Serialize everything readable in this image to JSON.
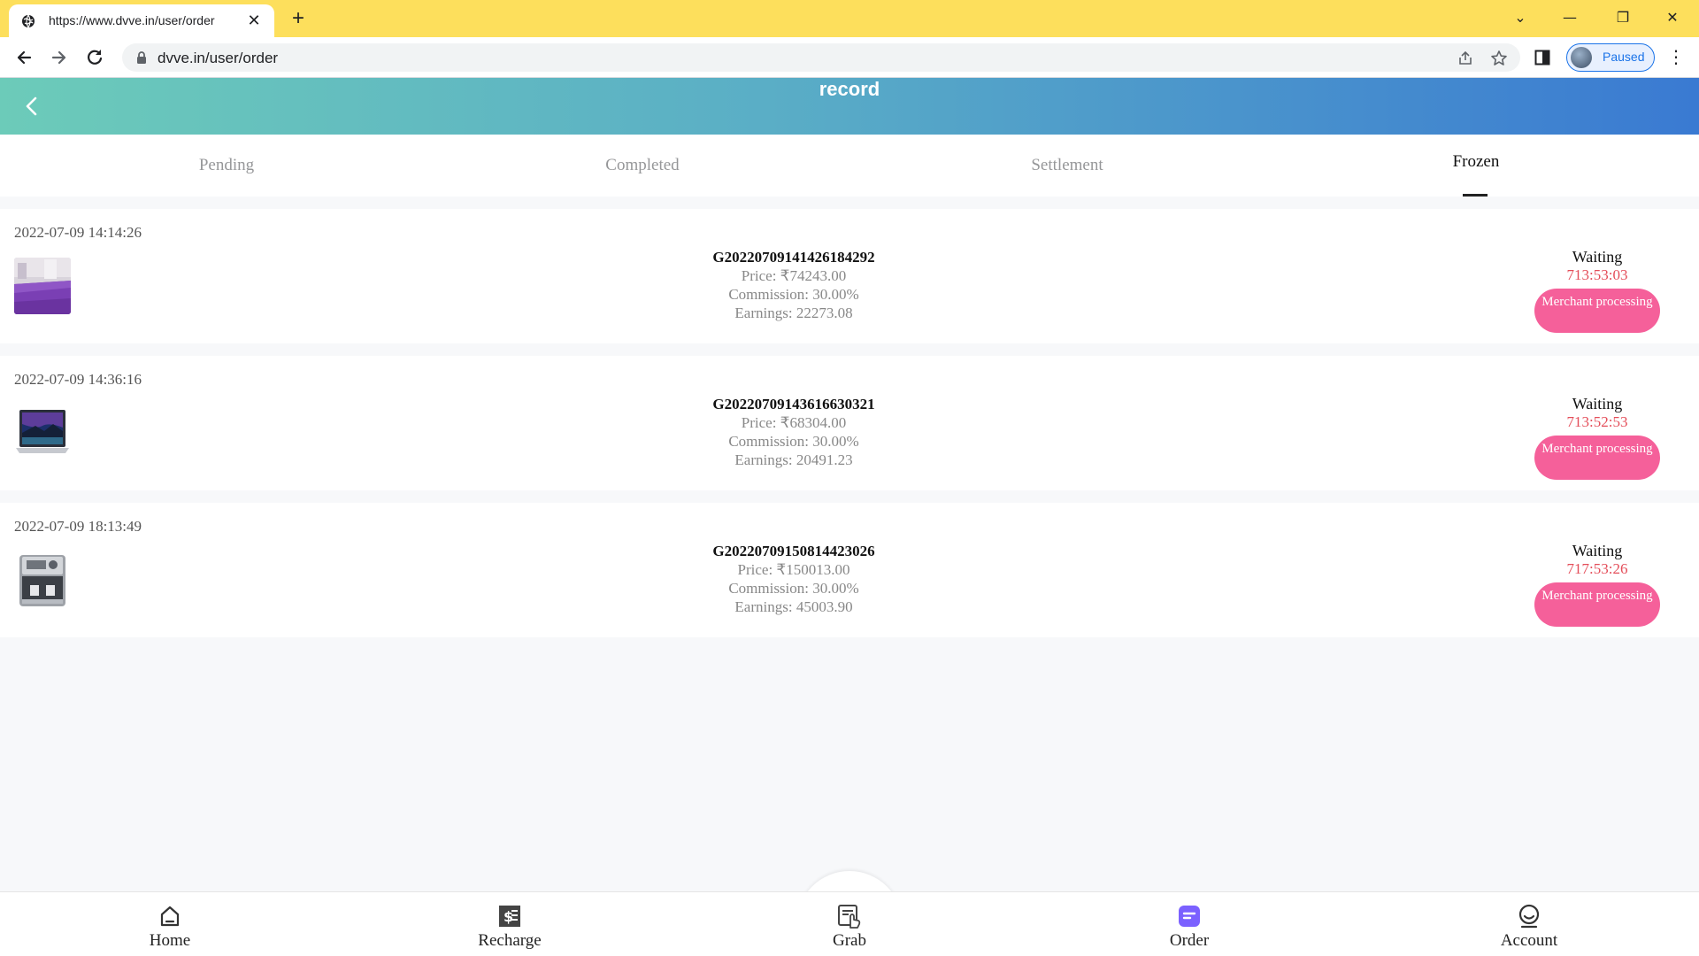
{
  "browser": {
    "tab_title": "https://www.dvve.in/user/order",
    "tab_close": "✕",
    "new_tab": "+",
    "url": "dvve.in/user/order",
    "profile_label": "Paused",
    "menu": "⋮",
    "window_controls": [
      "⌄",
      "—",
      "❐",
      "✕"
    ]
  },
  "header": {
    "title": "record"
  },
  "tabs": [
    {
      "label": "Pending",
      "active": false
    },
    {
      "label": "Completed",
      "active": false
    },
    {
      "label": "Settlement",
      "active": false
    },
    {
      "label": "Frozen",
      "active": true
    }
  ],
  "orders": [
    {
      "date": "2022-07-09 14:14:26",
      "order_no": "G20220709141426184292",
      "price": "Price: ₹74243.00",
      "commission": "Commission: 30.00%",
      "earnings": "Earnings: 22273.08",
      "status": "Waiting",
      "timer": "713:53:03",
      "action": "Merchant processing",
      "thumb": "purple-rug"
    },
    {
      "date": "2022-07-09 14:36:16",
      "order_no": "G20220709143616630321",
      "price": "Price: ₹68304.00",
      "commission": "Commission: 30.00%",
      "earnings": "Earnings: 20491.23",
      "status": "Waiting",
      "timer": "713:52:53",
      "action": "Merchant processing",
      "thumb": "laptop"
    },
    {
      "date": "2022-07-09 18:13:49",
      "order_no": "G20220709150814423026",
      "price": "Price: ₹150013.00",
      "commission": "Commission: 30.00%",
      "earnings": "Earnings: 45003.90",
      "status": "Waiting",
      "timer": "717:53:26",
      "action": "Merchant processing",
      "thumb": "coffee-machine"
    }
  ],
  "bottom_nav": [
    {
      "label": "Home",
      "icon": "home-icon"
    },
    {
      "label": "Recharge",
      "icon": "recharge-icon"
    },
    {
      "label": "Grab",
      "icon": "grab-icon"
    },
    {
      "label": "Order",
      "icon": "order-icon"
    },
    {
      "label": "Account",
      "icon": "account-icon"
    }
  ],
  "colors": {
    "browser_frame": "#fddf5c",
    "header_gradient_start": "#6ccbb9",
    "header_gradient_end": "#3a7ad2",
    "timer": "#e44d59",
    "merchant_button": "#f5609a",
    "order_nav_active": "#7b61ff"
  }
}
